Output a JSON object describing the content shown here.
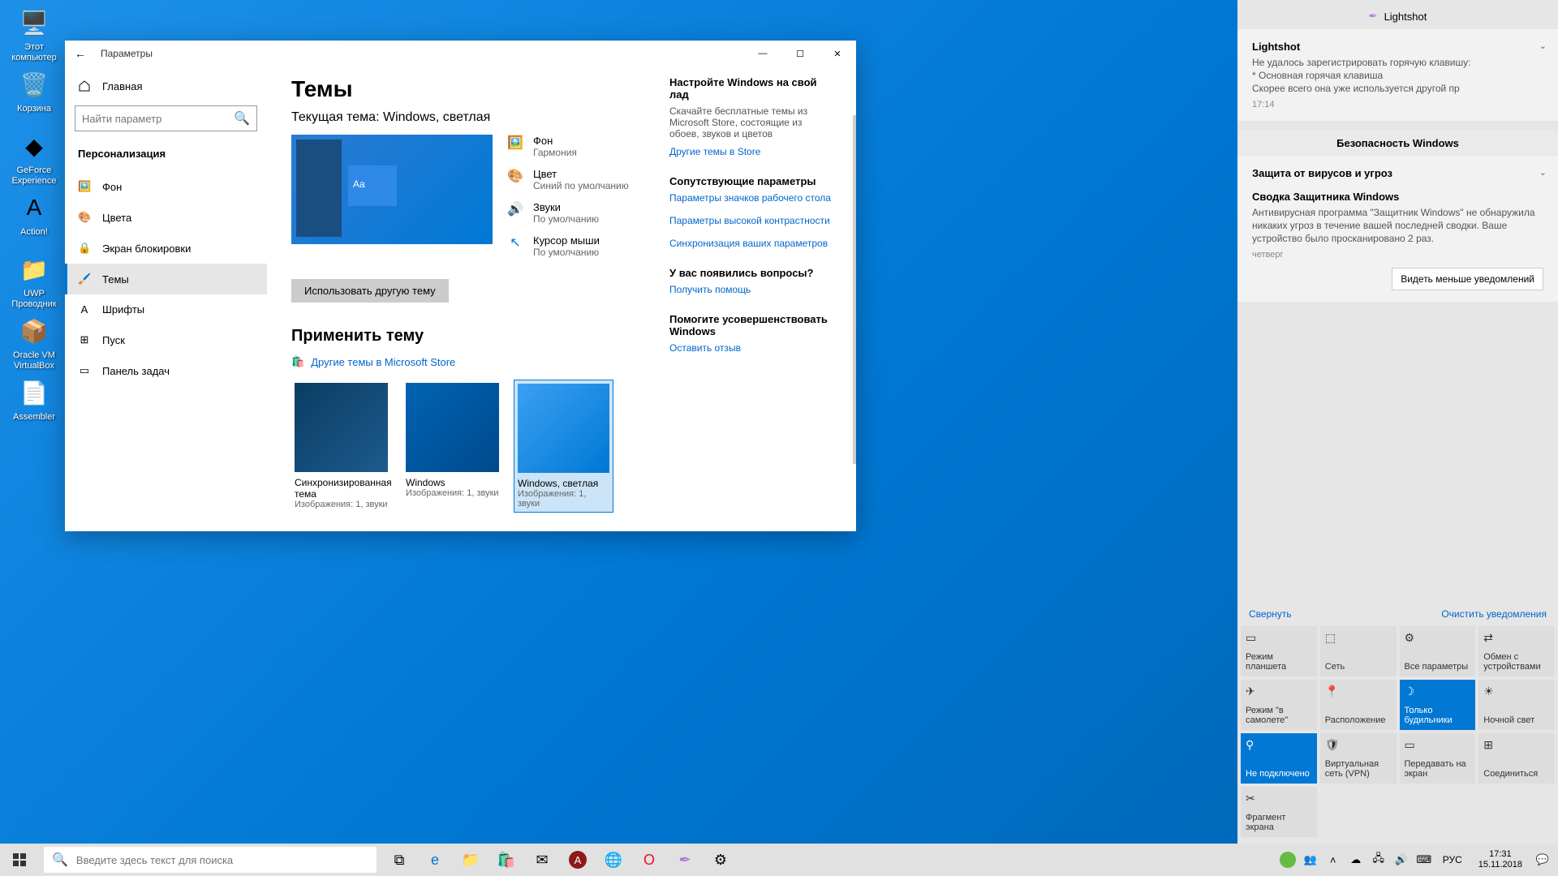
{
  "desktop": {
    "icons": [
      {
        "label": "Этот\nкомпьютер",
        "glyph": "🖥️"
      },
      {
        "label": "Корзина",
        "glyph": "🗑️"
      },
      {
        "label": "GeForce\nExperience",
        "glyph": "◆"
      },
      {
        "label": "Action!",
        "glyph": "A"
      },
      {
        "label": "UWP\nПроводник",
        "glyph": "📁"
      },
      {
        "label": "Oracle VM\nVirtualBox",
        "glyph": "📦"
      },
      {
        "label": "Assembler",
        "glyph": "📄"
      }
    ]
  },
  "settings": {
    "title": "Параметры",
    "home": "Главная",
    "search_placeholder": "Найти параметр",
    "category": "Персонализация",
    "nav": [
      {
        "label": "Фон",
        "active": false
      },
      {
        "label": "Цвета",
        "active": false
      },
      {
        "label": "Экран блокировки",
        "active": false
      },
      {
        "label": "Темы",
        "active": true
      },
      {
        "label": "Шрифты",
        "active": false
      },
      {
        "label": "Пуск",
        "active": false
      },
      {
        "label": "Панель задач",
        "active": false
      }
    ],
    "page": {
      "heading": "Темы",
      "current_prefix": "Текущая тема: ",
      "current_name": "Windows, светлая",
      "preview_tile": "Aa",
      "attrs": [
        {
          "title": "Фон",
          "sub": "Гармония"
        },
        {
          "title": "Цвет",
          "sub": "Синий по умолчанию"
        },
        {
          "title": "Звуки",
          "sub": "По умолчанию"
        },
        {
          "title": "Курсор мыши",
          "sub": "По умолчанию"
        }
      ],
      "use_other": "Использовать другую тему",
      "apply_heading": "Применить тему",
      "store_link": "Другие темы в Microsoft Store",
      "themes": [
        {
          "name": "Синхронизированная тема",
          "meta": "Изображения: 1, звуки",
          "cls": "dark"
        },
        {
          "name": "Windows",
          "meta": "Изображения: 1, звуки",
          "cls": "def"
        },
        {
          "name": "Windows, светлая",
          "meta": "Изображения: 1, звуки",
          "cls": "light",
          "selected": true
        }
      ]
    },
    "right": {
      "customize_title": "Настройте Windows на свой лад",
      "customize_text": "Скачайте бесплатные темы из Microsoft Store, состоящие из обоев, звуков и цветов",
      "customize_link": "Другие темы в Store",
      "related_title": "Сопутствующие параметры",
      "related_links": [
        "Параметры значков рабочего стола",
        "Параметры высокой контрастности",
        "Синхронизация ваших параметров"
      ],
      "help_title": "У вас появились вопросы?",
      "help_link": "Получить помощь",
      "feedback_title": "Помогите усовершенствовать Windows",
      "feedback_link": "Оставить отзыв"
    }
  },
  "action_center": {
    "app_header": "Lightshot",
    "notif1": {
      "title": "Lightshot",
      "body": "Не удалось зарегистрировать горячую клавишу:\n* Основная горячая клавиша\nСкорее всего она уже используется другой пр",
      "time": "17:14"
    },
    "group_header": "Безопасность Windows",
    "notif2": {
      "pre": "Защита от вирусов и угроз",
      "title": "Сводка Защитника Windows",
      "body": "Антивирусная программа \"Защитник Windows\" не обнаружила никаких угроз в течение вашей последней сводки. Ваше устройство было просканировано 2 раз.",
      "time": "четверг"
    },
    "less_btn": "Видеть меньше уведомлений",
    "collapse": "Свернуть",
    "clear": "Очистить уведомления",
    "quick": [
      {
        "label": "Режим планшета",
        "on": false
      },
      {
        "label": "Сеть",
        "on": false
      },
      {
        "label": "Все параметры",
        "on": false
      },
      {
        "label": "Обмен с устройствами",
        "on": false
      },
      {
        "label": "Режим \"в самолете\"",
        "on": false
      },
      {
        "label": "Расположение",
        "on": false
      },
      {
        "label": "Только будильники",
        "on": true
      },
      {
        "label": "Ночной свет",
        "on": false
      },
      {
        "label": "Не подключено",
        "on": true
      },
      {
        "label": "Виртуальная сеть (VPN)",
        "on": false
      },
      {
        "label": "Передавать на экран",
        "on": false
      },
      {
        "label": "Соединиться",
        "on": false
      },
      {
        "label": "Фрагмент экрана",
        "on": false
      }
    ]
  },
  "taskbar": {
    "search_placeholder": "Введите здесь текст для поиска",
    "lang": "РУС",
    "time": "17:31",
    "date": "15.11.2018"
  }
}
